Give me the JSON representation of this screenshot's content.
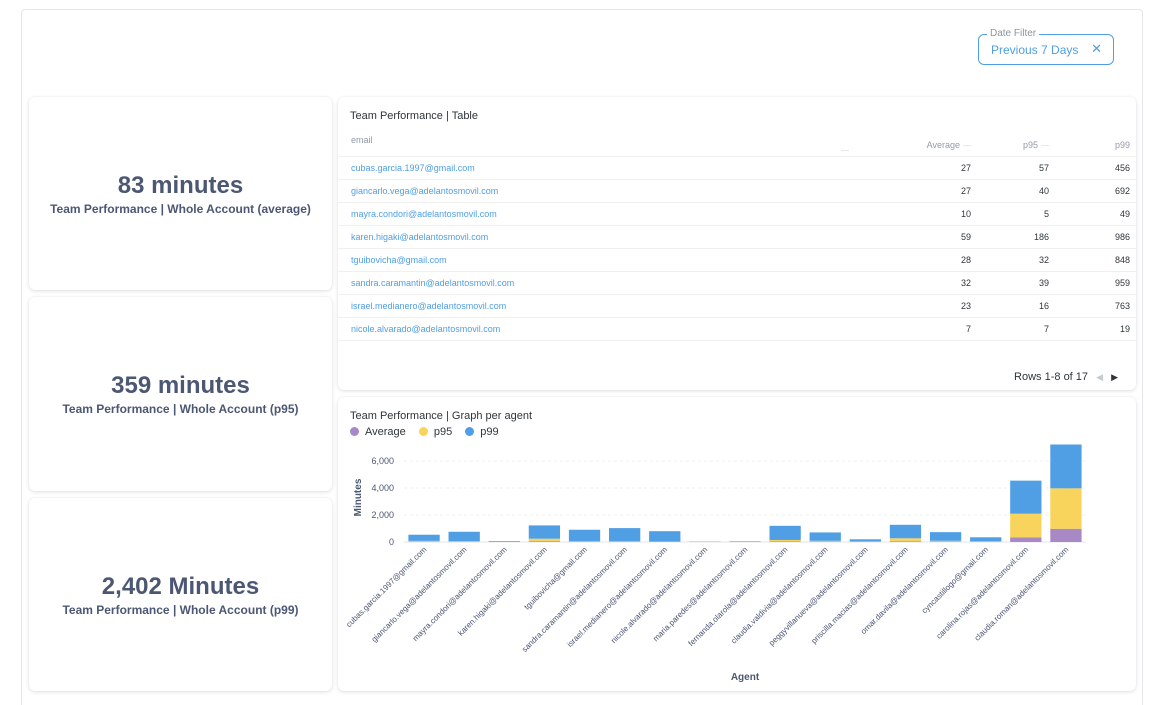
{
  "date_filter": {
    "label": "Date Filter",
    "value": "Previous 7 Days",
    "clear_icon": "close-icon"
  },
  "scalars": [
    {
      "value": "83 minutes",
      "title": "Team Performance | Whole Account (average)"
    },
    {
      "value": "359 minutes",
      "title": "Team Performance | Whole Account (p95)"
    },
    {
      "value": "2,402 Minutes",
      "title": "Team Performance | Whole Account (p99)"
    }
  ],
  "table": {
    "title": "Team Performance | Table",
    "columns": [
      "email",
      "Average",
      "p95",
      "p99"
    ],
    "rows": [
      [
        "cubas.garcia.1997@gmail.com",
        "27",
        "57",
        "456"
      ],
      [
        "giancarlo.vega@adelantosmovil.com",
        "27",
        "40",
        "692"
      ],
      [
        "mayra.condori@adelantosmovil.com",
        "10",
        "5",
        "49"
      ],
      [
        "karen.higaki@adelantosmovil.com",
        "59",
        "186",
        "986"
      ],
      [
        "tguibovicha@gmail.com",
        "28",
        "32",
        "848"
      ],
      [
        "sandra.caramantin@adelantosmovil.com",
        "32",
        "39",
        "959"
      ],
      [
        "israel.medianero@adelantosmovil.com",
        "23",
        "16",
        "763"
      ],
      [
        "nicole.alvarado@adelantosmovil.com",
        "7",
        "7",
        "19"
      ]
    ],
    "pagination": "Rows 1-8 of 17"
  },
  "chart_title": "Team Performance | Graph per agent",
  "chart_data": {
    "type": "bar",
    "stacked": true,
    "categories": [
      "cubas.garcia.1997@gmail.com",
      "giancarlo.vega@adelantosmovil.com",
      "mayra.condori@adelantosmovil.com",
      "karen.higaki@adelantosmovil.com",
      "tguibovicha@gmail.com",
      "sandra.caramantin@adelantosmovil.com",
      "israel.medianero@adelantosmovil.com",
      "nicole.alvarado@adelantosmovil.com",
      "maria.paredes@adelantosmovil.com",
      "fernanda.olarola@adelantosmovil.com",
      "claudia.valdivia@adelantosmovil.com",
      "peggyvillanueva@adelantosmovil.com",
      "priscilla.macias@adelantosmovil.com",
      "omar.davila@adelantosmovil.com",
      "cyncastillogo@gmail.com",
      "carolina.rojas@adelantosmovil.com",
      "claudia.roman@adelantosmovil.com"
    ],
    "series": [
      {
        "name": "Average",
        "color": "#a989c5",
        "values": [
          27,
          27,
          10,
          59,
          28,
          32,
          23,
          7,
          10,
          50,
          30,
          15,
          55,
          30,
          20,
          350,
          980
        ]
      },
      {
        "name": "p95",
        "color": "#f9d45c",
        "values": [
          57,
          40,
          5,
          186,
          32,
          39,
          16,
          7,
          5,
          100,
          60,
          25,
          220,
          60,
          30,
          1750,
          3000
        ]
      },
      {
        "name": "p99",
        "color": "#509ee3",
        "values": [
          456,
          692,
          49,
          986,
          848,
          959,
          763,
          19,
          35,
          1050,
          620,
          160,
          1000,
          640,
          300,
          2450,
          3250
        ]
      }
    ],
    "xlabel": "Agent",
    "ylabel": "Minutes",
    "yticks": [
      "0",
      "2,000",
      "4,000",
      "6,000"
    ],
    "ylim": [
      0,
      6600
    ],
    "legend_position": "top-left"
  }
}
